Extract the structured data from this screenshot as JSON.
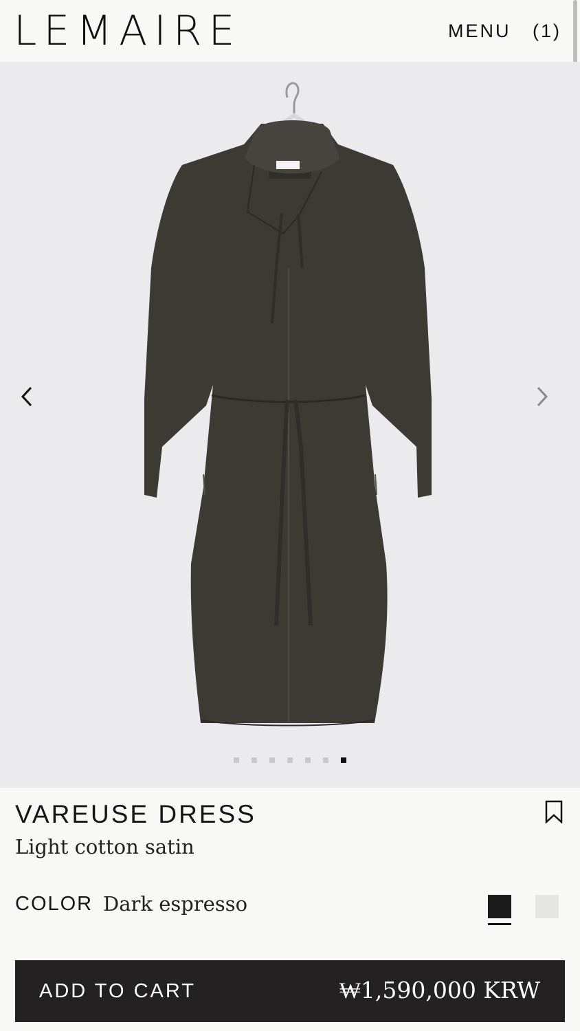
{
  "header": {
    "logo": "LEMAIRE",
    "menu_label": "MENU",
    "cart_count": "(1)"
  },
  "gallery": {
    "image_description": "dark espresso dress on hanger",
    "label_tag": "LEMAIRE",
    "prev_icon": "chevron-left-icon",
    "next_icon": "chevron-right-icon",
    "total_images": 7,
    "active_index": 7
  },
  "product": {
    "name": "VAREUSE DRESS",
    "material": "Light cotton satin",
    "color_label": "COLOR",
    "color_value": "Dark espresso",
    "swatches": [
      {
        "name": "Dark espresso",
        "hex": "#1a1a1a",
        "selected": true
      },
      {
        "name": "Light",
        "hex": "#e6e6e4",
        "selected": false
      }
    ],
    "bookmark_icon": "bookmark-icon"
  },
  "cart": {
    "button_label": "ADD TO CART",
    "price": "₩1,590,000 KRW"
  },
  "colors": {
    "background": "#f8f8f6",
    "gallery_bg": "#ebebee",
    "dress": "#3b3a33",
    "cart_bar": "#232122"
  }
}
